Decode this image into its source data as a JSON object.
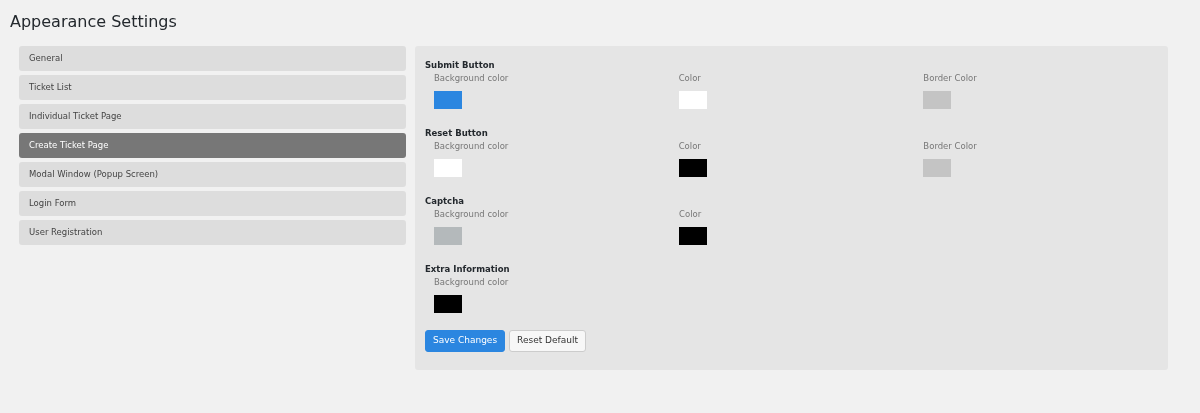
{
  "page_title": "Appearance Settings",
  "sidebar": {
    "items": [
      {
        "label": "General",
        "selected": false
      },
      {
        "label": "Ticket List",
        "selected": false
      },
      {
        "label": "Individual Ticket Page",
        "selected": false
      },
      {
        "label": "Create Ticket Page",
        "selected": true
      },
      {
        "label": "Modal Window (Popup Screen)",
        "selected": false
      },
      {
        "label": "Login Form",
        "selected": false
      },
      {
        "label": "User Registration",
        "selected": false
      }
    ]
  },
  "sections": [
    {
      "title": "Submit Button",
      "fields": [
        {
          "label": "Background color",
          "color": "#2b86e0"
        },
        {
          "label": "Color",
          "color": "#ffffff"
        },
        {
          "label": "Border Color",
          "color": "#c4c4c4"
        }
      ]
    },
    {
      "title": "Reset Button",
      "fields": [
        {
          "label": "Background color",
          "color": "#ffffff"
        },
        {
          "label": "Color",
          "color": "#000000"
        },
        {
          "label": "Border Color",
          "color": "#c4c4c4"
        }
      ]
    },
    {
      "title": "Captcha",
      "fields": [
        {
          "label": "Background color",
          "color": "#b4b9bb"
        },
        {
          "label": "Color",
          "color": "#000000"
        }
      ]
    },
    {
      "title": "Extra Information",
      "fields": [
        {
          "label": "Background color",
          "color": "#000000"
        }
      ]
    }
  ],
  "buttons": [
    {
      "label": "Save Changes",
      "kind": "primary"
    },
    {
      "label": "Reset Default",
      "kind": "secondary"
    }
  ]
}
